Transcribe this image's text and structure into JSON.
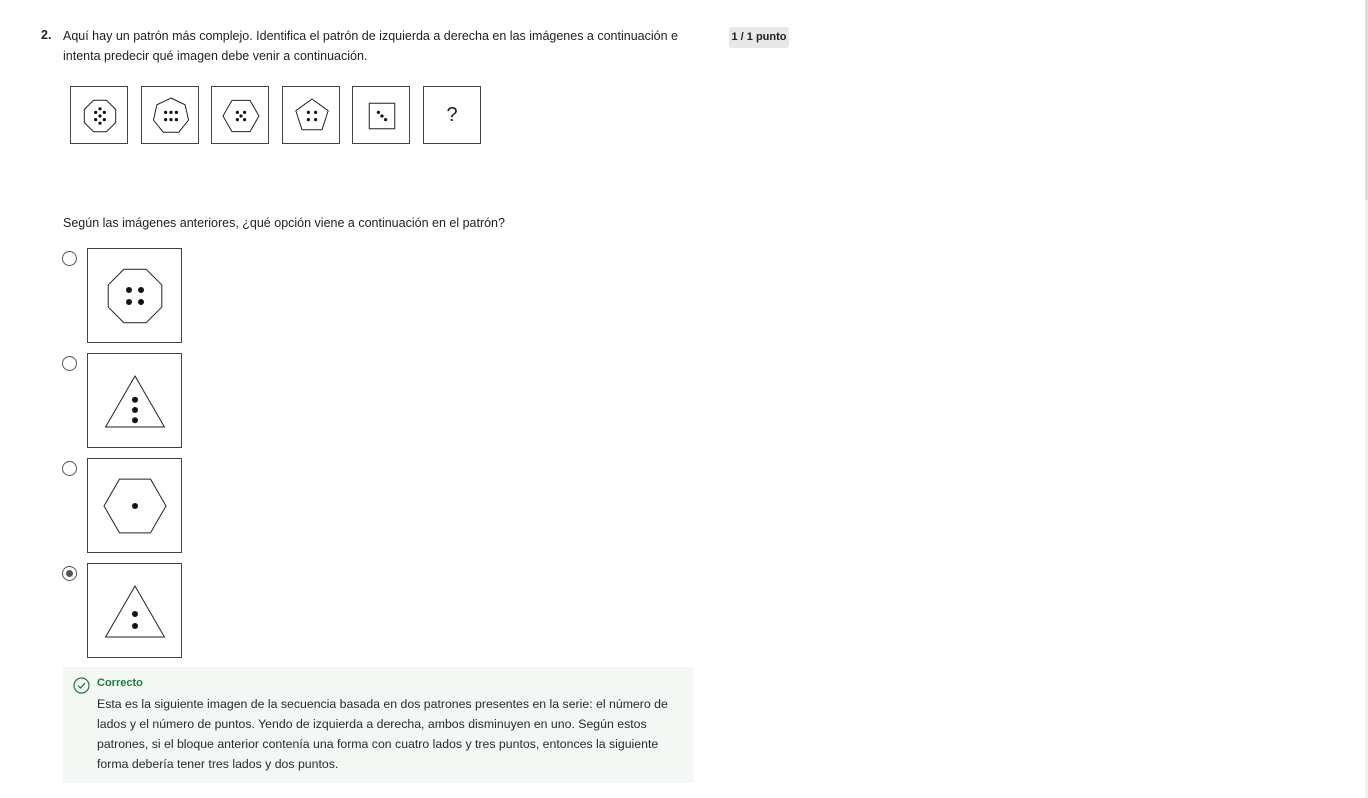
{
  "question": {
    "number": "2.",
    "text": "Aquí hay un patrón más complejo. Identifica el patrón de izquierda a derecha en las imágenes a continuación e intenta predecir qué imagen debe venir a continuación.",
    "score": "1 / 1 punto"
  },
  "sequence": [
    {
      "shape": "octagon",
      "dots": 7
    },
    {
      "shape": "heptagon",
      "dots": 6
    },
    {
      "shape": "hexagon",
      "dots": 5
    },
    {
      "shape": "pentagon",
      "dots": 4
    },
    {
      "shape": "square",
      "dots": 3
    },
    {
      "shape": "unknown",
      "label": "?"
    }
  ],
  "prompt": "Según las imágenes anteriores, ¿qué opción viene a continuación en el patrón?",
  "options": [
    {
      "shape": "octagon",
      "dots": 4,
      "selected": false
    },
    {
      "shape": "triangle",
      "dots": 3,
      "selected": false
    },
    {
      "shape": "hexagon",
      "dots": 1,
      "selected": false
    },
    {
      "shape": "triangle",
      "dots": 2,
      "selected": true
    }
  ],
  "feedback": {
    "status_icon": "check-circle-icon",
    "title": "Correcto",
    "text": "Esta es la siguiente imagen de la secuencia basada en dos patrones presentes en la serie: el número de lados y el número de puntos. Yendo de izquierda a derecha, ambos disminuyen en uno. Según estos patrones, si el bloque anterior contenía una forma con cuatro lados y tres puntos, entonces la siguiente forma debería tener tres lados y dos puntos.",
    "color": "#1f7a3e"
  }
}
